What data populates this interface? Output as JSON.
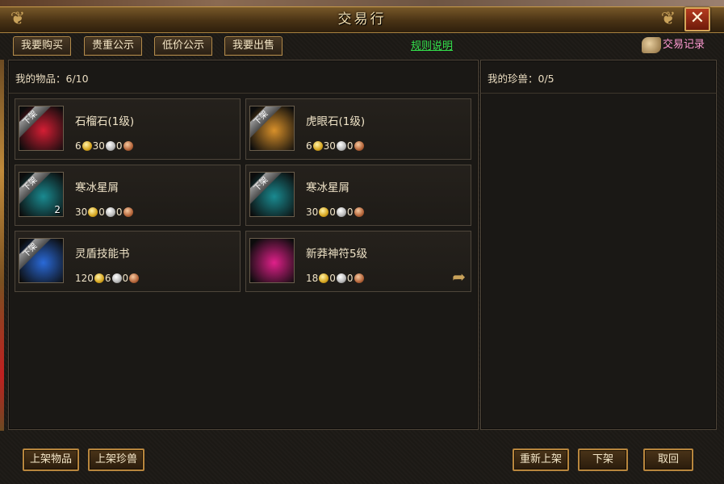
{
  "window": {
    "title": "交易行",
    "close_label": "✕"
  },
  "tabs": [
    {
      "label": "我要购买"
    },
    {
      "label": "贵重公示"
    },
    {
      "label": "低价公示"
    },
    {
      "label": "我要出售"
    }
  ],
  "rules_link": "规则说明",
  "records_label": "交易记录",
  "left_panel": {
    "header": "我的物品：6/10",
    "items": [
      {
        "name": "石榴石(1级)",
        "ribbon": "下架",
        "qty": "",
        "price": [
          "6",
          "30",
          "0"
        ],
        "icon": "red-gem-icon",
        "color": "#d41e34"
      },
      {
        "name": "虎眼石(1级)",
        "ribbon": "下架",
        "qty": "",
        "price": [
          "6",
          "30",
          "0"
        ],
        "icon": "orange-gem-icon",
        "color": "#d8902a"
      },
      {
        "name": "寒冰星屑",
        "ribbon": "下架",
        "qty": "2",
        "price": [
          "30",
          "0",
          "0"
        ],
        "icon": "ice-stardust-icon",
        "color": "#1a8a90"
      },
      {
        "name": "寒冰星屑",
        "ribbon": "下架",
        "qty": "",
        "price": [
          "30",
          "0",
          "0"
        ],
        "icon": "ice-stardust-icon",
        "color": "#1a8a90"
      },
      {
        "name": "灵盾技能书",
        "ribbon": "下架",
        "qty": "",
        "price": [
          "120",
          "6",
          "0"
        ],
        "icon": "shield-skillbook-icon",
        "color": "#2a6ad8"
      },
      {
        "name": "新莽神符5级",
        "ribbon": "",
        "qty": "",
        "price": [
          "18",
          "0",
          "0"
        ],
        "icon": "green-rune-icon",
        "color": "#e0208a"
      }
    ]
  },
  "right_panel": {
    "header": "我的珍兽：0/5"
  },
  "bottom_buttons": {
    "list_item": "上架物品",
    "list_pet": "上架珍兽",
    "relist": "重新上架",
    "delist": "下架",
    "cancel": "取回"
  }
}
